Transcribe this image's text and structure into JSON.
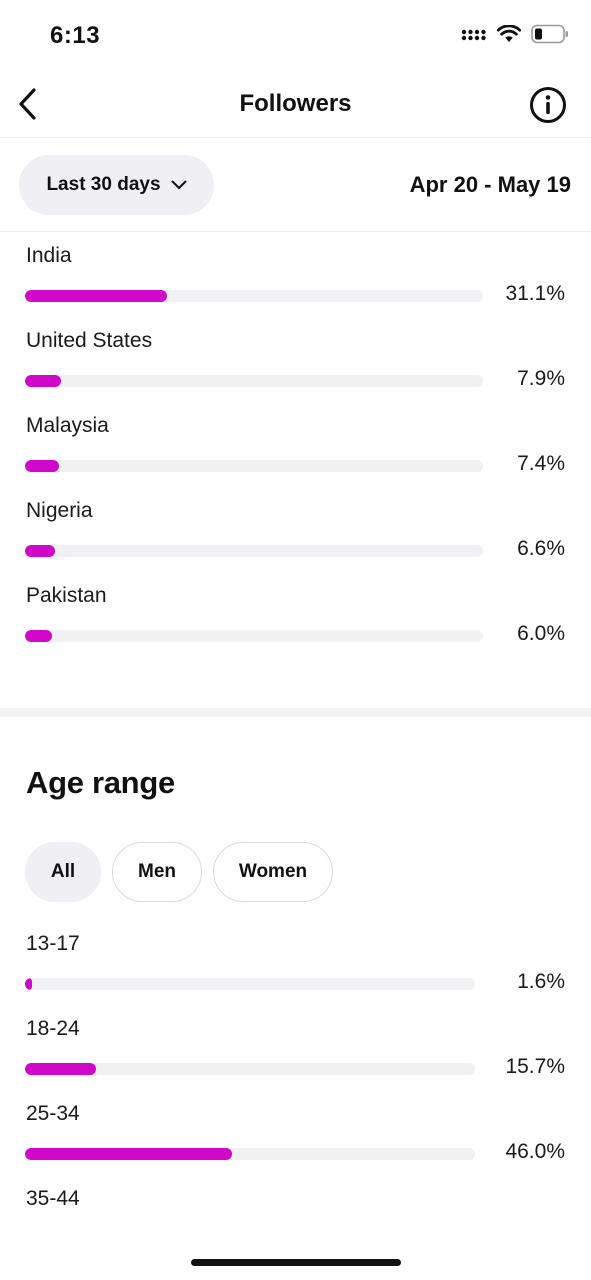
{
  "status_bar": {
    "time": "6:13"
  },
  "nav": {
    "title": "Followers"
  },
  "filter": {
    "range_label": "Last 30 days",
    "date_range": "Apr 20 - May 19"
  },
  "countries": [
    {
      "label": "India",
      "value": "31.1%",
      "pct": 31.1
    },
    {
      "label": "United States",
      "value": "7.9%",
      "pct": 7.9
    },
    {
      "label": "Malaysia",
      "value": "7.4%",
      "pct": 7.4
    },
    {
      "label": "Nigeria",
      "value": "6.6%",
      "pct": 6.6
    },
    {
      "label": "Pakistan",
      "value": "6.0%",
      "pct": 6.0
    }
  ],
  "age_range": {
    "title": "Age range",
    "segments": [
      "All",
      "Men",
      "Women"
    ],
    "active_segment": "All",
    "items": [
      {
        "label": "13-17",
        "value": "1.6%",
        "pct": 1.6
      },
      {
        "label": "18-24",
        "value": "15.7%",
        "pct": 15.7
      },
      {
        "label": "25-34",
        "value": "46.0%",
        "pct": 46.0
      },
      {
        "label": "35-44"
      }
    ]
  },
  "colors": {
    "accent": "#d006c8",
    "track": "#f1f1f4",
    "pill_bg": "#efeff4"
  }
}
